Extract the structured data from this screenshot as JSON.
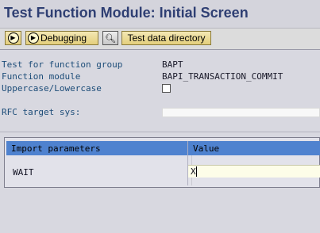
{
  "window": {
    "title": "Test Function Module: Initial Screen"
  },
  "toolbar": {
    "execute_tooltip": "Execute",
    "debugging_label": "Debugging",
    "test_data_label": "Test data directory"
  },
  "fields": {
    "function_group_label": "Test for function group",
    "function_group_value": "BAPT",
    "function_module_label": "Function module",
    "function_module_value": "BAPI_TRANSACTION_COMMIT",
    "case_label": "Uppercase/Lowercase",
    "rfc_label": "RFC target sys:",
    "rfc_value": ""
  },
  "table": {
    "headers": [
      "Import parameters",
      "Value"
    ],
    "rows": [
      {
        "parameter": "WAIT",
        "value": "X"
      }
    ]
  },
  "colors": {
    "title": "#2f3f73",
    "header_bg": "#4f82cf",
    "label": "#1c4c78"
  }
}
